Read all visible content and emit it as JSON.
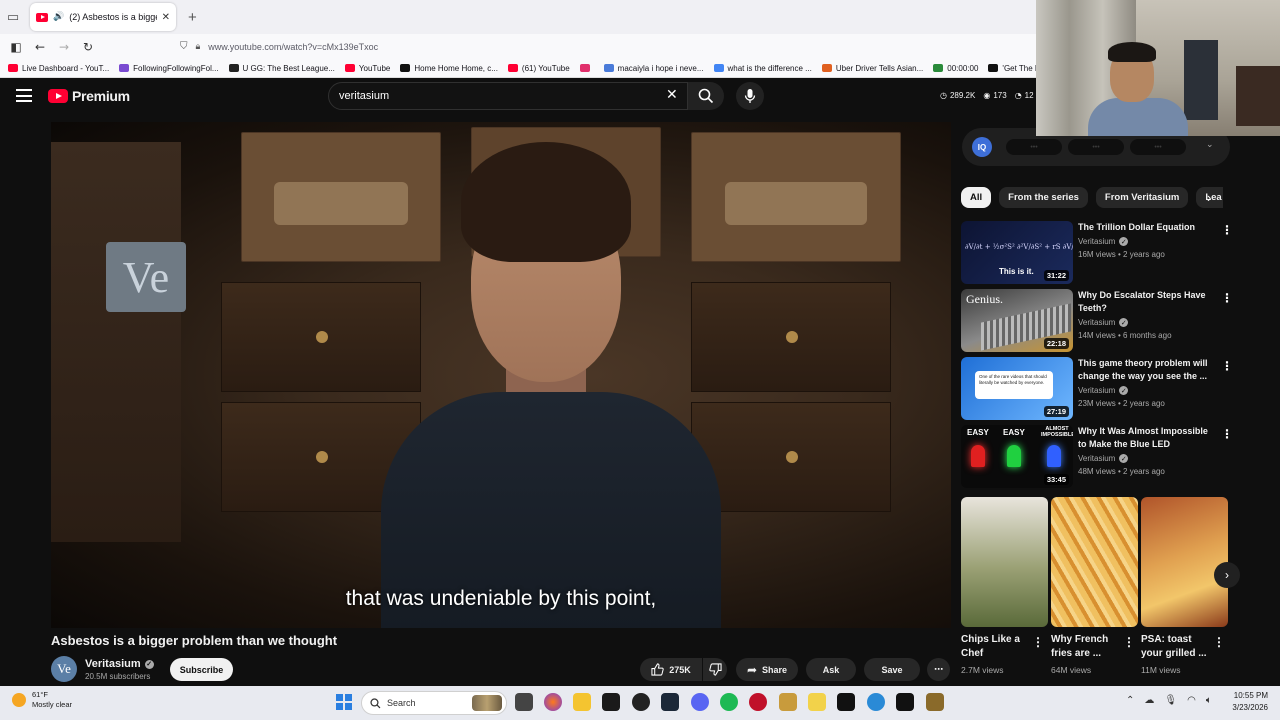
{
  "browser": {
    "tab_title": "(2) Asbestos is a bigger pro",
    "url": "www.youtube.com/watch?v=cMx139eTxoc",
    "bookmarks": [
      {
        "label": "Live Dashboard - YouT...",
        "color": "#ff0033"
      },
      {
        "label": "FollowingFollowingFol...",
        "color": "#7a4bd1"
      },
      {
        "label": "U GG: The Best League...",
        "color": "#222222"
      },
      {
        "label": "YouTube",
        "color": "#ff0033"
      },
      {
        "label": "Home Home Home, c...",
        "color": "#111111"
      },
      {
        "label": "(61) YouTube",
        "color": "#ff0033"
      },
      {
        "label": "",
        "color": "#e1306c"
      },
      {
        "label": "macaiyla i hope i neve...",
        "color": "#4a7bd9"
      },
      {
        "label": "what is the difference ...",
        "color": "#4285f4"
      },
      {
        "label": "Uber Driver Tells Asian...",
        "color": "#e06020"
      },
      {
        "label": "00:00:00",
        "color": "#2a8a3a"
      },
      {
        "label": "'Get The F--- Out Of M",
        "color": "#111111"
      }
    ]
  },
  "header": {
    "logo_text": "Premium",
    "search_value": "veritasium",
    "stats": [
      "289.2K",
      "173",
      "12"
    ]
  },
  "video": {
    "caption": "that was undeniable by this point,",
    "title": "Asbestos is a bigger problem than we thought",
    "channel": {
      "avatar": "Ve",
      "name": "Veritasium",
      "subs": "20.5M subscribers"
    },
    "subscribe_label": "Subscribe",
    "likes": "275K",
    "share_label": "Share",
    "ask_label": "Ask",
    "save_label": "Save",
    "frame_text": {
      "ve_sign": "Ve"
    }
  },
  "sidebar": {
    "iq_logo": "IQ",
    "iq_pills": [
      "•••",
      "•••",
      "•••"
    ],
    "chips": [
      "All",
      "From the series",
      "From Veritasium",
      "Lea"
    ],
    "recommendations": [
      {
        "title": "The Trillion Dollar Equation",
        "channel": "Veritasium",
        "meta": "16M views • 2 years ago",
        "duration": "31:22",
        "thumb_text": "This is it."
      },
      {
        "title": "Why Do Escalator Steps Have Teeth?",
        "channel": "Veritasium",
        "meta": "14M views • 6 months ago",
        "duration": "22:18",
        "thumb_text": "Genius."
      },
      {
        "title": "This game theory problem will change the way you see the ...",
        "channel": "Veritasium",
        "meta": "23M views • 2 years ago",
        "duration": "27:19",
        "thumb_text": "One of the rare videos that should literally be watched by everyone."
      },
      {
        "title": "Why It Was Almost Impossible to Make the Blue LED",
        "channel": "Veritasium",
        "meta": "48M views • 2 years ago",
        "duration": "33:45",
        "thumb_labels": [
          "EASY",
          "EASY",
          "ALMOST IMPOSSIBLE"
        ]
      }
    ],
    "shorts": [
      {
        "title": "Chips Like a Chef",
        "views": "2.7M views"
      },
      {
        "title": "Why French fries are ...",
        "views": "64M views"
      },
      {
        "title": "PSA: toast your grilled ...",
        "views": "11M views"
      }
    ]
  },
  "taskbar": {
    "temp": "61°F",
    "condition": "Mostly clear",
    "search_label": "Search",
    "time": "10:55 PM",
    "date": "3/23/2026"
  }
}
